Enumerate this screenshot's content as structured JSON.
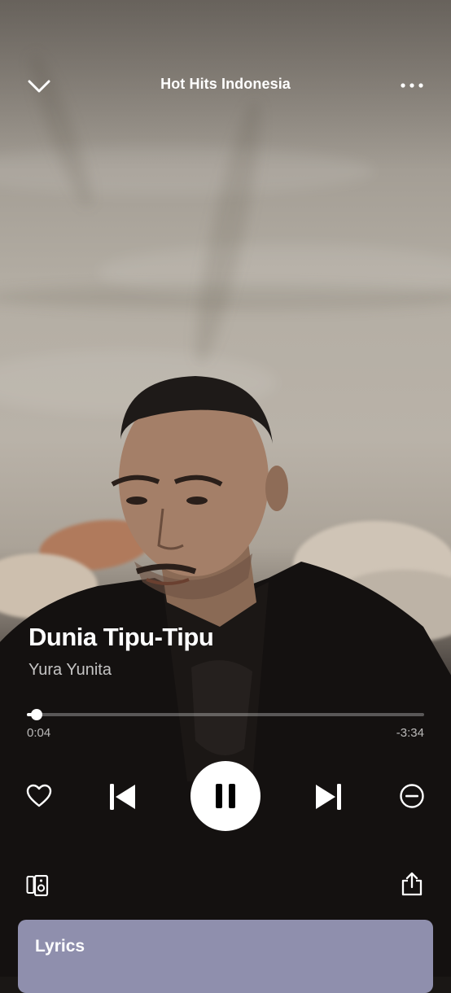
{
  "header": {
    "playlist_title": "Hot Hits Indonesia",
    "collapse_icon": "chevron-down-icon",
    "more_icon": "more-horizontal-icon"
  },
  "track": {
    "title": "Dunia Tipu-Tipu",
    "artist": "Yura Yunita",
    "elapsed": "0:04",
    "remaining": "-3:34",
    "progress": 0.025
  },
  "controls": {
    "like_icon": "heart-icon",
    "previous_icon": "skip-back-icon",
    "play_pause_icon": "pause-icon",
    "next_icon": "skip-forward-icon",
    "hide_icon": "minus-circle-icon",
    "devices_icon": "connect-devices-icon",
    "share_icon": "share-icon"
  },
  "lyrics": {
    "label": "Lyrics"
  },
  "colors": {
    "lyrics_card": "#8f8fad",
    "accent": "#ffffff"
  }
}
